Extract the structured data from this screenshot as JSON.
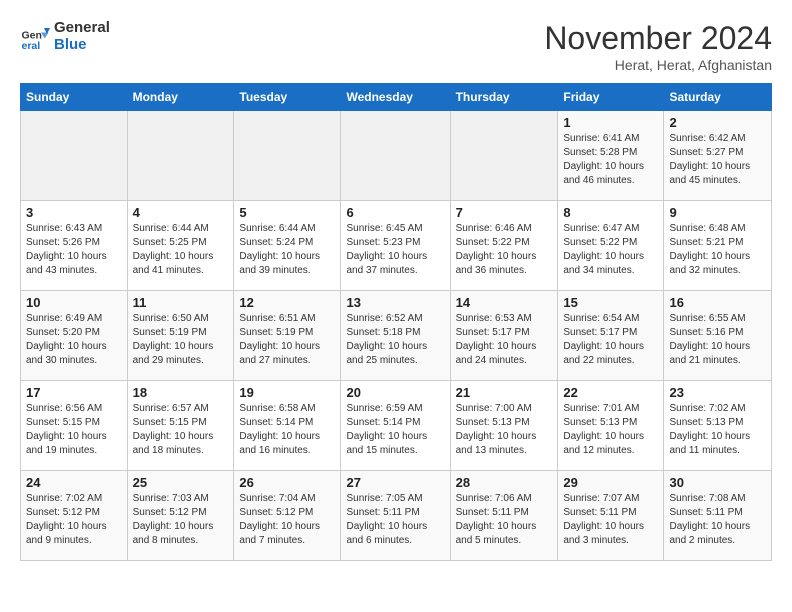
{
  "logo": {
    "general": "General",
    "blue": "Blue"
  },
  "title": "November 2024",
  "location": "Herat, Herat, Afghanistan",
  "weekdays": [
    "Sunday",
    "Monday",
    "Tuesday",
    "Wednesday",
    "Thursday",
    "Friday",
    "Saturday"
  ],
  "weeks": [
    [
      {
        "day": "",
        "info": ""
      },
      {
        "day": "",
        "info": ""
      },
      {
        "day": "",
        "info": ""
      },
      {
        "day": "",
        "info": ""
      },
      {
        "day": "",
        "info": ""
      },
      {
        "day": "1",
        "info": "Sunrise: 6:41 AM\nSunset: 5:28 PM\nDaylight: 10 hours\nand 46 minutes."
      },
      {
        "day": "2",
        "info": "Sunrise: 6:42 AM\nSunset: 5:27 PM\nDaylight: 10 hours\nand 45 minutes."
      }
    ],
    [
      {
        "day": "3",
        "info": "Sunrise: 6:43 AM\nSunset: 5:26 PM\nDaylight: 10 hours\nand 43 minutes."
      },
      {
        "day": "4",
        "info": "Sunrise: 6:44 AM\nSunset: 5:25 PM\nDaylight: 10 hours\nand 41 minutes."
      },
      {
        "day": "5",
        "info": "Sunrise: 6:44 AM\nSunset: 5:24 PM\nDaylight: 10 hours\nand 39 minutes."
      },
      {
        "day": "6",
        "info": "Sunrise: 6:45 AM\nSunset: 5:23 PM\nDaylight: 10 hours\nand 37 minutes."
      },
      {
        "day": "7",
        "info": "Sunrise: 6:46 AM\nSunset: 5:22 PM\nDaylight: 10 hours\nand 36 minutes."
      },
      {
        "day": "8",
        "info": "Sunrise: 6:47 AM\nSunset: 5:22 PM\nDaylight: 10 hours\nand 34 minutes."
      },
      {
        "day": "9",
        "info": "Sunrise: 6:48 AM\nSunset: 5:21 PM\nDaylight: 10 hours\nand 32 minutes."
      }
    ],
    [
      {
        "day": "10",
        "info": "Sunrise: 6:49 AM\nSunset: 5:20 PM\nDaylight: 10 hours\nand 30 minutes."
      },
      {
        "day": "11",
        "info": "Sunrise: 6:50 AM\nSunset: 5:19 PM\nDaylight: 10 hours\nand 29 minutes."
      },
      {
        "day": "12",
        "info": "Sunrise: 6:51 AM\nSunset: 5:19 PM\nDaylight: 10 hours\nand 27 minutes."
      },
      {
        "day": "13",
        "info": "Sunrise: 6:52 AM\nSunset: 5:18 PM\nDaylight: 10 hours\nand 25 minutes."
      },
      {
        "day": "14",
        "info": "Sunrise: 6:53 AM\nSunset: 5:17 PM\nDaylight: 10 hours\nand 24 minutes."
      },
      {
        "day": "15",
        "info": "Sunrise: 6:54 AM\nSunset: 5:17 PM\nDaylight: 10 hours\nand 22 minutes."
      },
      {
        "day": "16",
        "info": "Sunrise: 6:55 AM\nSunset: 5:16 PM\nDaylight: 10 hours\nand 21 minutes."
      }
    ],
    [
      {
        "day": "17",
        "info": "Sunrise: 6:56 AM\nSunset: 5:15 PM\nDaylight: 10 hours\nand 19 minutes."
      },
      {
        "day": "18",
        "info": "Sunrise: 6:57 AM\nSunset: 5:15 PM\nDaylight: 10 hours\nand 18 minutes."
      },
      {
        "day": "19",
        "info": "Sunrise: 6:58 AM\nSunset: 5:14 PM\nDaylight: 10 hours\nand 16 minutes."
      },
      {
        "day": "20",
        "info": "Sunrise: 6:59 AM\nSunset: 5:14 PM\nDaylight: 10 hours\nand 15 minutes."
      },
      {
        "day": "21",
        "info": "Sunrise: 7:00 AM\nSunset: 5:13 PM\nDaylight: 10 hours\nand 13 minutes."
      },
      {
        "day": "22",
        "info": "Sunrise: 7:01 AM\nSunset: 5:13 PM\nDaylight: 10 hours\nand 12 minutes."
      },
      {
        "day": "23",
        "info": "Sunrise: 7:02 AM\nSunset: 5:13 PM\nDaylight: 10 hours\nand 11 minutes."
      }
    ],
    [
      {
        "day": "24",
        "info": "Sunrise: 7:02 AM\nSunset: 5:12 PM\nDaylight: 10 hours\nand 9 minutes."
      },
      {
        "day": "25",
        "info": "Sunrise: 7:03 AM\nSunset: 5:12 PM\nDaylight: 10 hours\nand 8 minutes."
      },
      {
        "day": "26",
        "info": "Sunrise: 7:04 AM\nSunset: 5:12 PM\nDaylight: 10 hours\nand 7 minutes."
      },
      {
        "day": "27",
        "info": "Sunrise: 7:05 AM\nSunset: 5:11 PM\nDaylight: 10 hours\nand 6 minutes."
      },
      {
        "day": "28",
        "info": "Sunrise: 7:06 AM\nSunset: 5:11 PM\nDaylight: 10 hours\nand 5 minutes."
      },
      {
        "day": "29",
        "info": "Sunrise: 7:07 AM\nSunset: 5:11 PM\nDaylight: 10 hours\nand 3 minutes."
      },
      {
        "day": "30",
        "info": "Sunrise: 7:08 AM\nSunset: 5:11 PM\nDaylight: 10 hours\nand 2 minutes."
      }
    ]
  ]
}
